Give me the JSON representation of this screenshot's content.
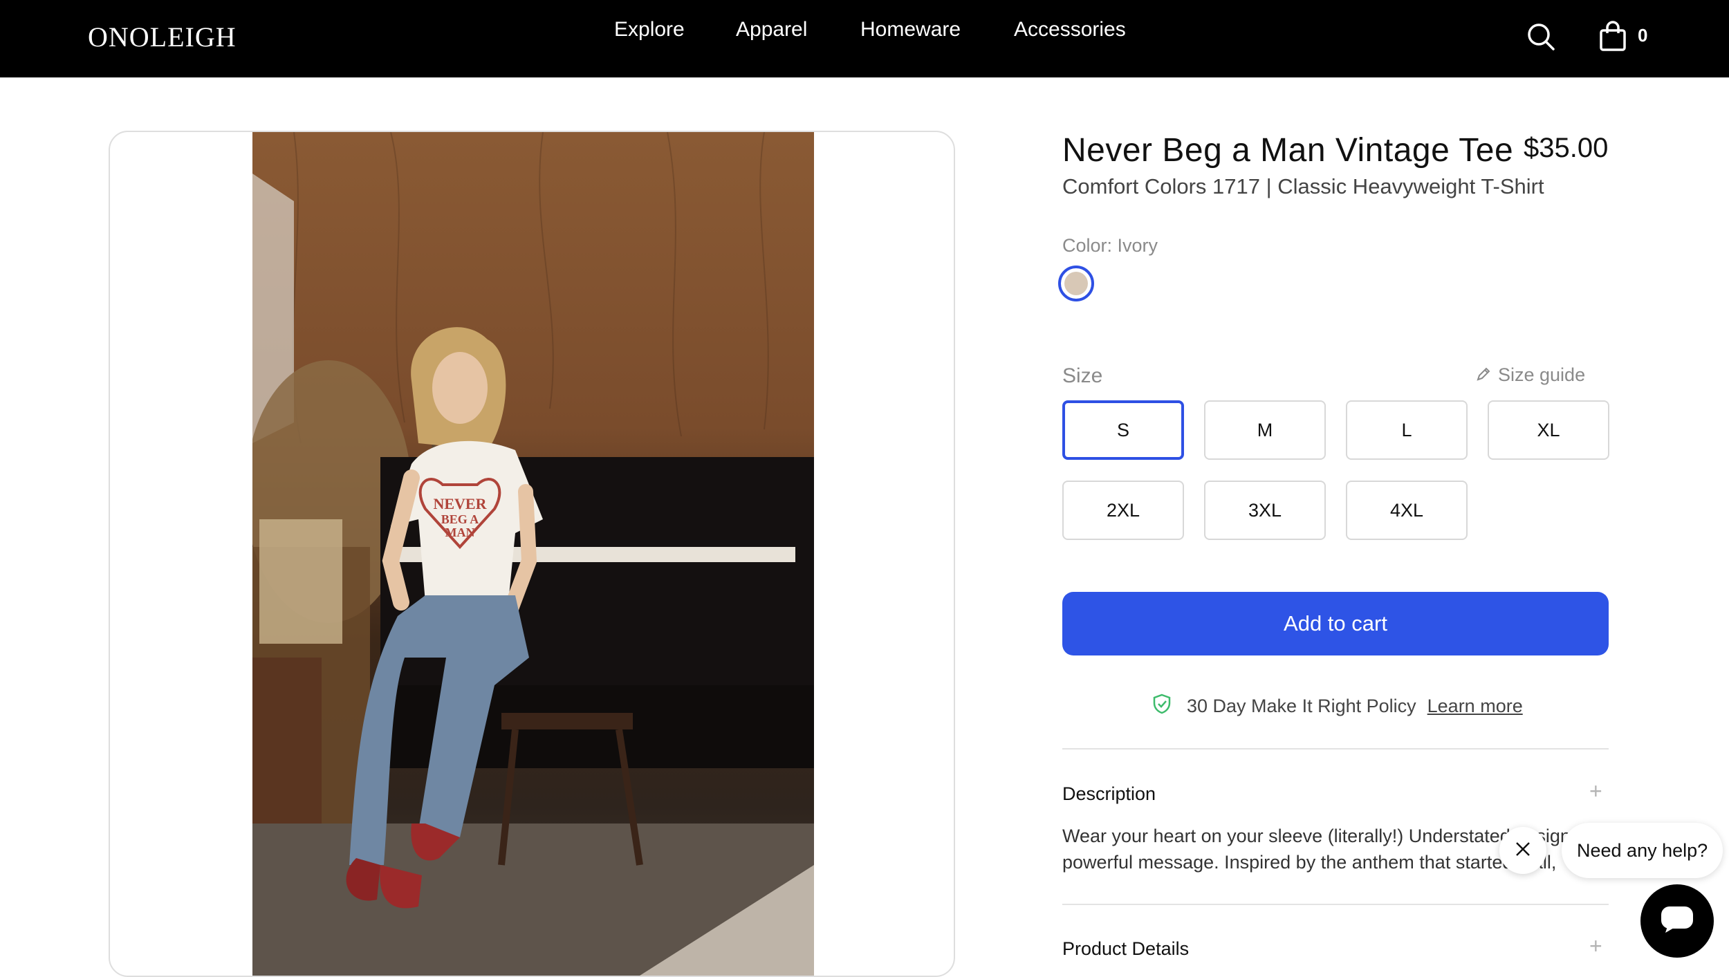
{
  "header": {
    "logo": "ONOLEIGH",
    "nav": [
      "Explore",
      "Apparel",
      "Homeware",
      "Accessories"
    ],
    "cart_count": "0"
  },
  "product": {
    "title": "Never Beg a Man Vintage Tee",
    "price": "$35.00",
    "subtitle": "Comfort Colors 1717 | Classic Heavyweight T-Shirt",
    "color_label": "Color: Ivory",
    "swatch_color": "#d8c8b6",
    "size_label": "Size",
    "size_guide": "Size guide",
    "sizes": [
      "S",
      "M",
      "L",
      "XL",
      "2XL",
      "3XL",
      "4XL"
    ],
    "selected_size": "S",
    "add_to_cart": "Add to cart",
    "policy_text": "30 Day Make It Right Policy",
    "policy_link": "Learn more",
    "description_title": "Description",
    "description_line1": "Wear your heart on your sleeve (literally!) Understated design",
    "description_line2": "powerful message. Inspired by the anthem that started it all,",
    "details_title": "Product Details",
    "shirt_print": [
      "NEVER",
      "BEG A",
      "MAN"
    ]
  },
  "chat": {
    "prompt": "Need any help?"
  },
  "colors": {
    "accent": "#2e54e6",
    "header_bg": "#000000",
    "policy_check": "#3dbb6b"
  },
  "icons": [
    "search-icon",
    "bag-icon",
    "pencil-icon",
    "shield-check-icon",
    "plus-icon",
    "close-icon",
    "chat-icon"
  ]
}
